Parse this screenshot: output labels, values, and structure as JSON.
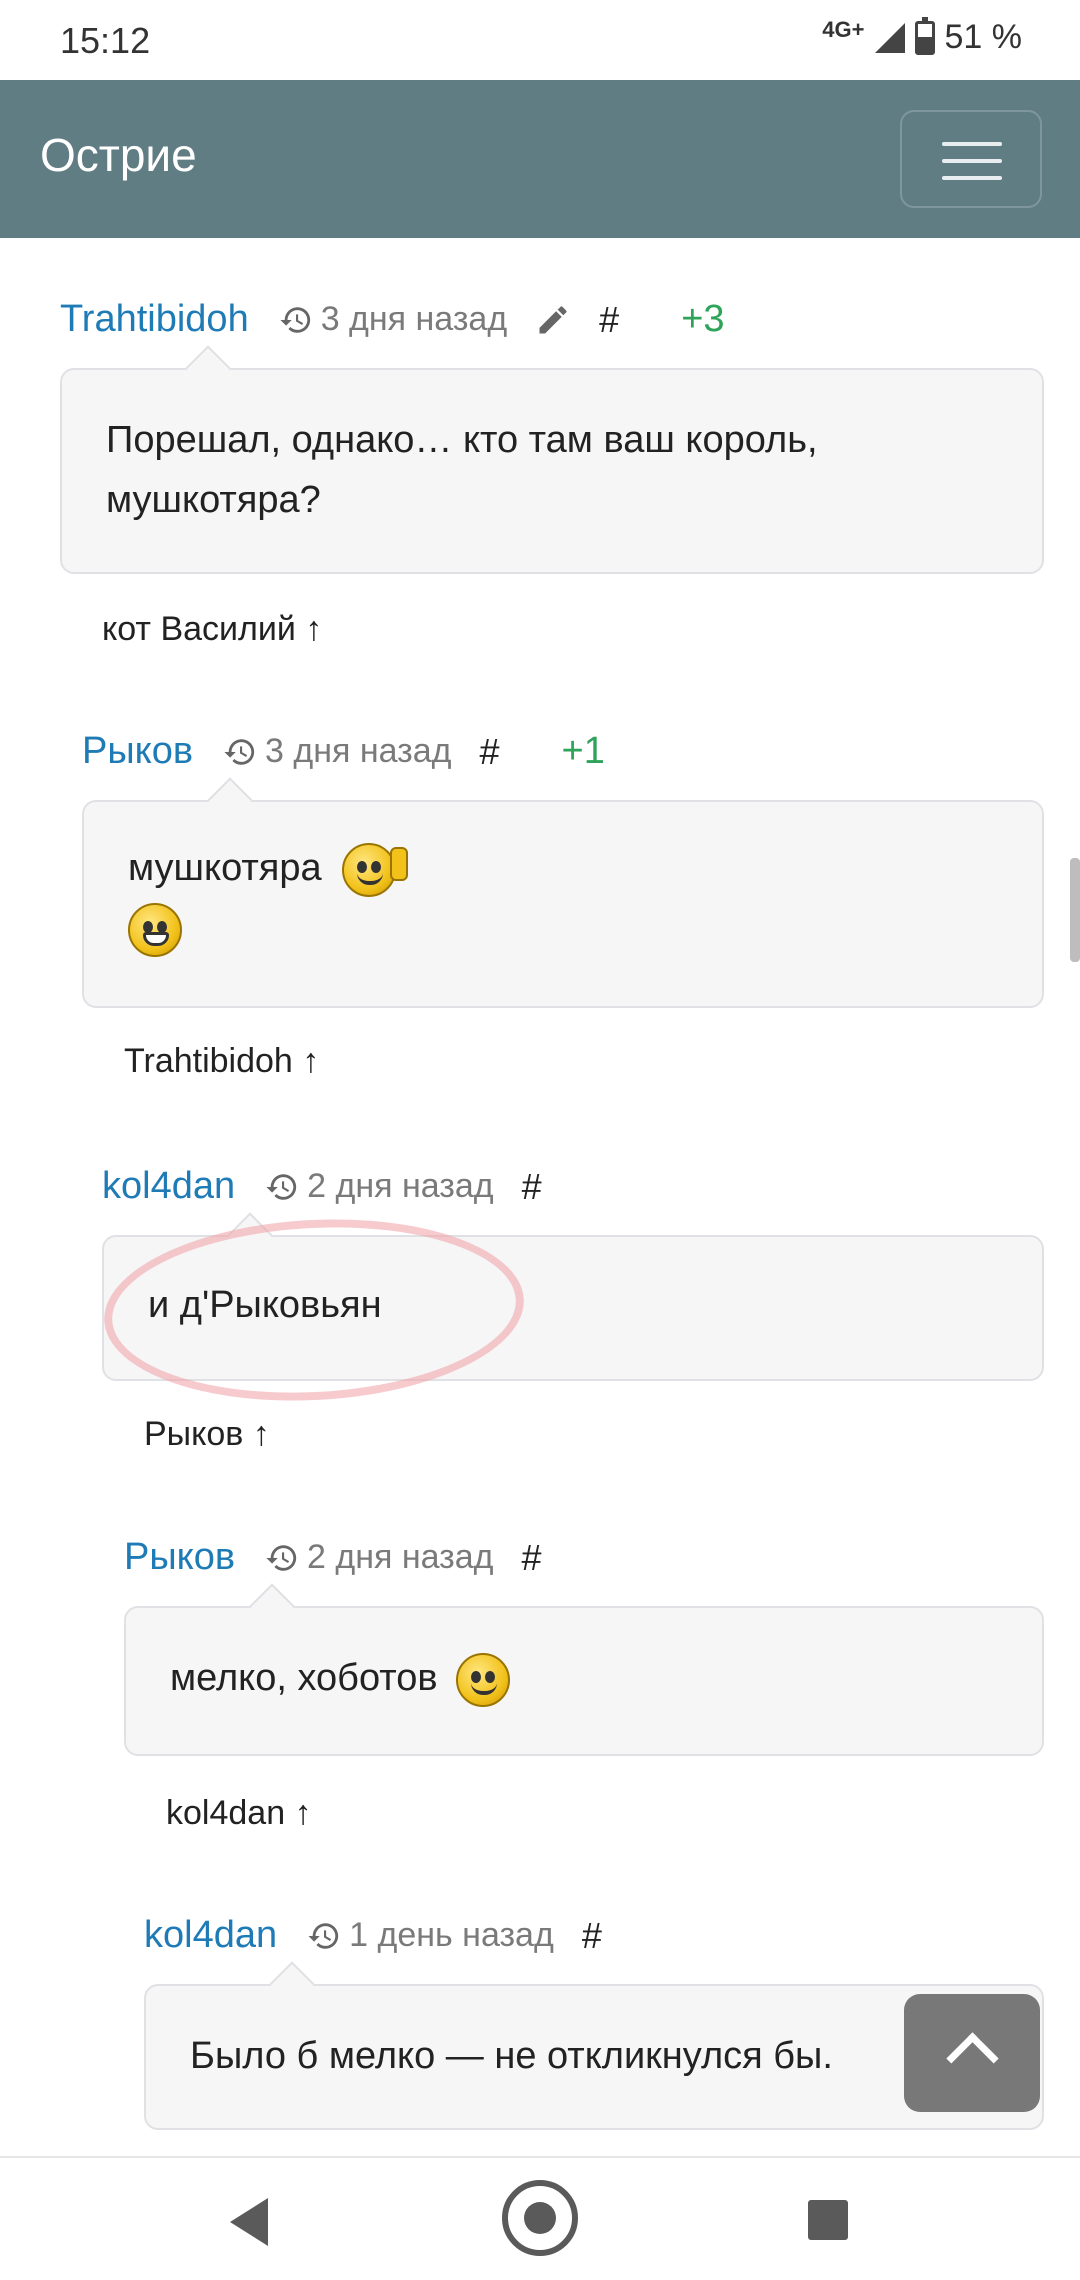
{
  "status_bar": {
    "time": "15:12",
    "network": "4G+",
    "battery": "51 %",
    "battery_level": 0.51
  },
  "navbar": {
    "brand": "Острие"
  },
  "comments": [
    {
      "author": "Trahtibidoh",
      "time": "3 дня назад",
      "hash": "#",
      "score": "+3",
      "text": "Порешал, однако… кто там ваш король, мушкотяра?",
      "reply_to": "кот Василий ↑"
    },
    {
      "author": "Рыков",
      "time": "3 дня назад",
      "hash": "#",
      "score": "+1",
      "text": "мушкотяра",
      "reply_to": "Trahtibidoh ↑"
    },
    {
      "author": "kol4dan",
      "time": "2 дня назад",
      "hash": "#",
      "text": "и д'Рыковьян",
      "reply_to": "Рыков ↑"
    },
    {
      "author": "Рыков",
      "time": "2 дня назад",
      "hash": "#",
      "text": "мелко, хоботов",
      "reply_to": "kol4dan ↑"
    },
    {
      "author": "kol4dan",
      "time": "1 день назад",
      "hash": "#",
      "text": "Было б мелко — не откликнулся бы."
    }
  ],
  "icons": {
    "history": "history-icon",
    "edit": "pencil-icon",
    "scroll_top": "chevron-up-icon"
  }
}
